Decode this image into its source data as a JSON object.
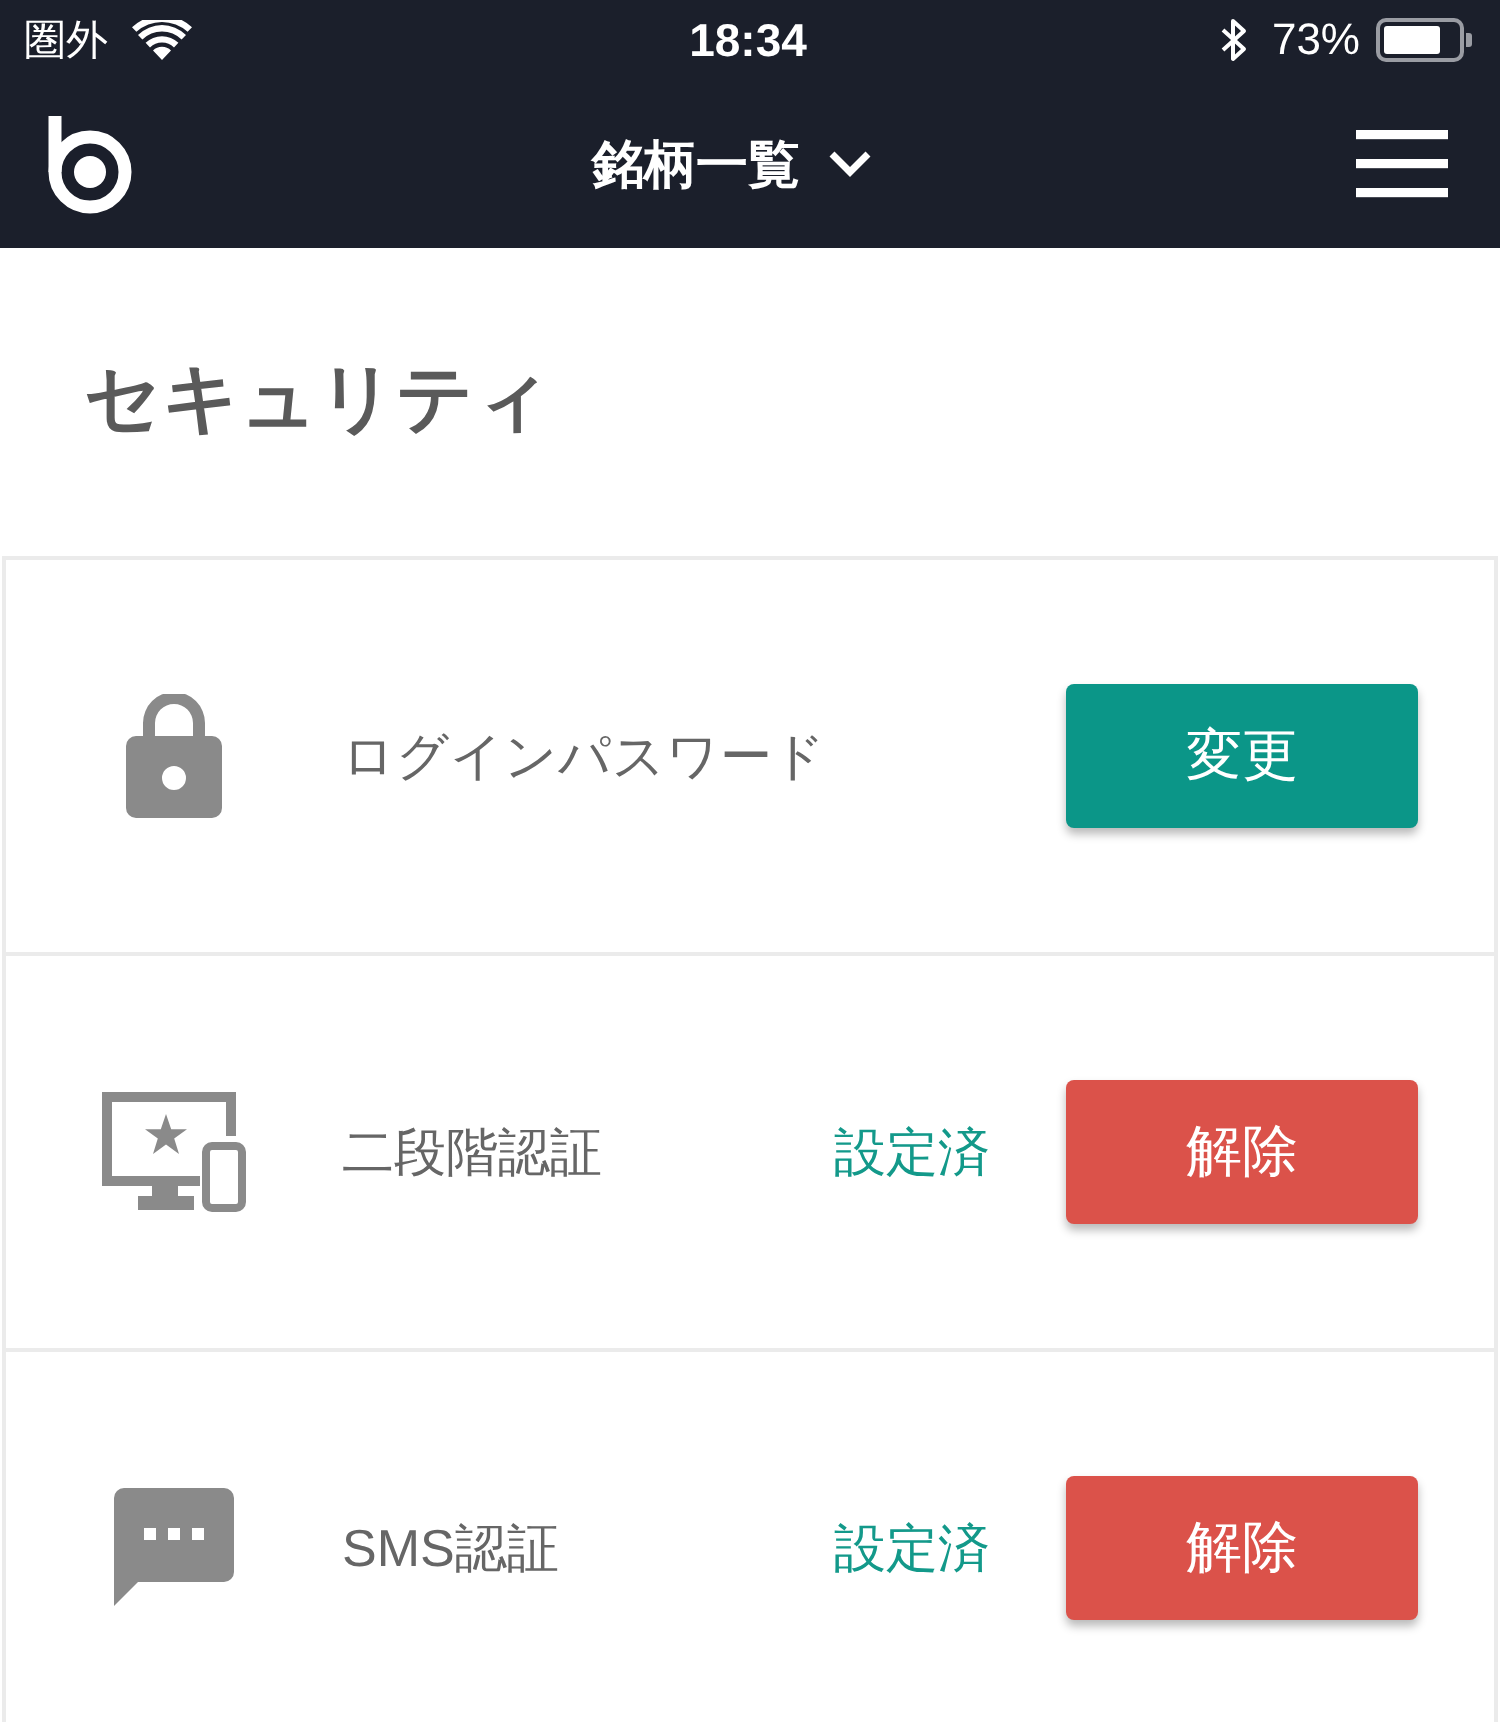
{
  "status_bar": {
    "carrier": "圏外",
    "time": "18:34",
    "battery": "73%"
  },
  "nav_bar": {
    "title": "銘柄一覧"
  },
  "page": {
    "title": "セキュリティ"
  },
  "security_items": [
    {
      "kind": "password",
      "label": "ログインパスワード",
      "button": {
        "kind": "change",
        "label": "変更"
      }
    },
    {
      "kind": "two-factor",
      "label": "二段階認証",
      "status": "設定済",
      "button": {
        "kind": "remove",
        "label": "解除"
      }
    },
    {
      "kind": "sms",
      "label": "SMS認証",
      "status": "設定済",
      "button": {
        "kind": "remove",
        "label": "解除"
      }
    }
  ]
}
